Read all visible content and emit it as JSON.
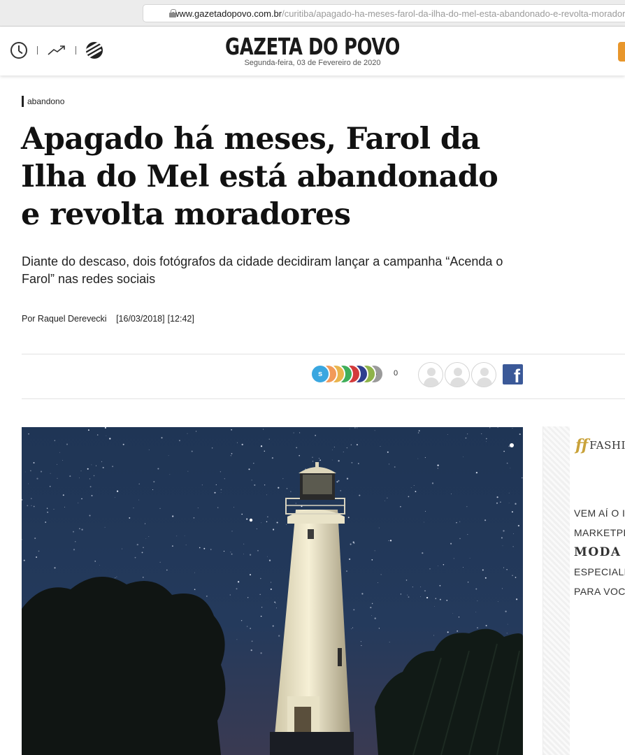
{
  "browser": {
    "url_host": "www.gazetadopovo.com.br",
    "url_path": "/curitiba/apagado-ha-meses-farol-da-ilha-do-mel-esta-abandonado-e-revolta-moradores"
  },
  "header": {
    "brand": "GAZETA DO POVO",
    "date": "Segunda-feira, 03 de Fevereiro de 2020",
    "icons": [
      "clock-icon",
      "trending-icon",
      "gp-logo-icon"
    ],
    "accent_color": "#e8962b"
  },
  "article": {
    "tag": "abandono",
    "headline": "Apagado há meses, Farol da Ilha do Mel está abandonado e revolta moradores",
    "subtitle": "Diante do descaso, dois fotógrafos da cidade decidiram lançar a campanha “Acenda o Farol” nas redes sociais",
    "author": "Por Raquel Derevecki",
    "date": "[16/03/2018]",
    "time": "[12:42]"
  },
  "share": {
    "first_label": "S",
    "count": "0",
    "colors": [
      "#3aa7e0",
      "#f29a59",
      "#e9b44c",
      "#3fae5a",
      "#d33b3b",
      "#2f3f8f",
      "#8fb34a",
      "#9a9a9a"
    ],
    "more_label": "•••",
    "facebook_label": "f",
    "facebook_color": "#3b5998"
  },
  "ad": {
    "logo_mark": "ff",
    "logo_text": "FASHI",
    "lines": [
      "VEM AÍ O I",
      "MARKETPL",
      "MODA A",
      "ESPECIALN",
      "PARA VOC"
    ]
  }
}
